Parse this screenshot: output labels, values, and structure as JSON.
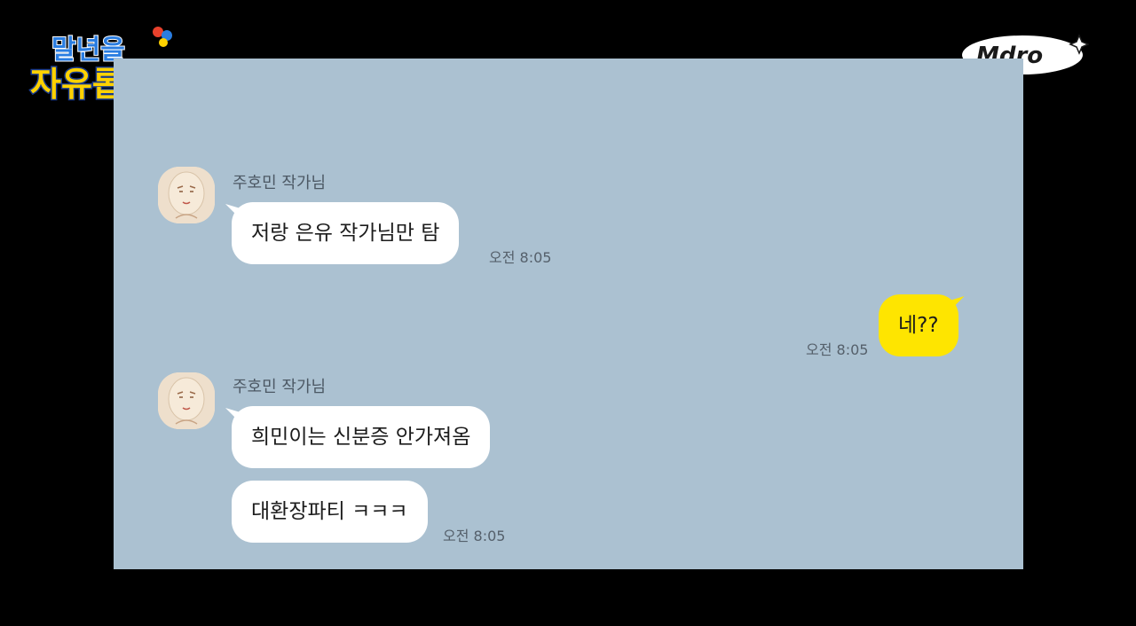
{
  "show_logo": {
    "line1": "말년을",
    "line2": "자유롭게",
    "colors": [
      "#2a7de1",
      "#ffd200",
      "#e8412c"
    ]
  },
  "channel_logo": {
    "text": "Mdro"
  },
  "chat": {
    "background": "#abc1d1",
    "messages": [
      {
        "sender": "주호민 작가님",
        "texts": [
          "저랑 은유 작가님만 탐"
        ],
        "time": "오전 8:05"
      },
      {
        "mine": true,
        "texts": [
          "네??"
        ],
        "time": "오전 8:05",
        "bubble_color": "#fee500"
      },
      {
        "sender": "주호민 작가님",
        "texts": [
          "희민이는 신분증 안가져옴",
          "대환장파티 ㅋㅋㅋ"
        ],
        "time": "오전 8:05"
      }
    ]
  }
}
